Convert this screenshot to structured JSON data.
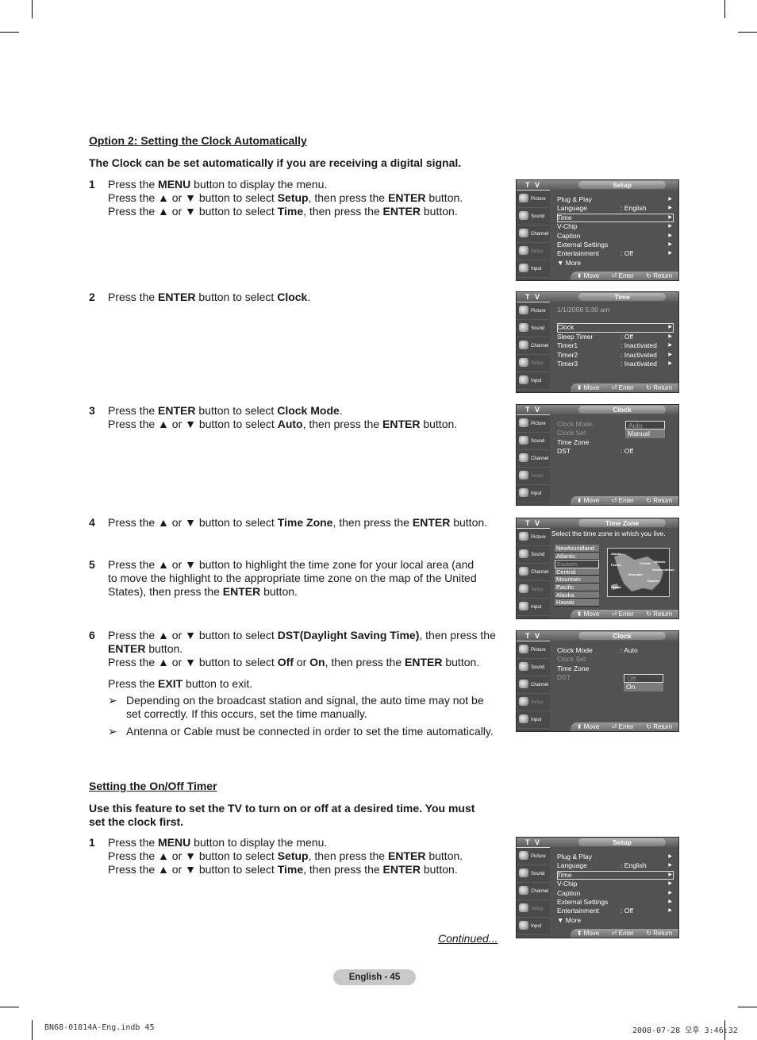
{
  "section1": {
    "heading": "Option 2: Setting the Clock Automatically",
    "intro": "The Clock can be set automatically if you are receiving a digital signal.",
    "steps": [
      {
        "num": "1",
        "lines": [
          [
            "Press the ",
            {
              "b": "MENU"
            },
            " button to display the menu."
          ],
          [
            "Press the ▲ or ▼ button to select ",
            {
              "b": "Setup"
            },
            ", then press the ",
            {
              "b": "ENTER"
            },
            " button."
          ],
          [
            "Press the ▲ or ▼ button to select ",
            {
              "b": "Time"
            },
            ", then press the ",
            {
              "b": "ENTER"
            },
            " button."
          ]
        ]
      },
      {
        "num": "2",
        "lines": [
          [
            "Press the ",
            {
              "b": "ENTER"
            },
            " button to select ",
            {
              "b": "Clock"
            },
            "."
          ]
        ]
      },
      {
        "num": "3",
        "lines": [
          [
            "Press the ",
            {
              "b": "ENTER"
            },
            " button to select ",
            {
              "b": "Clock Mode"
            },
            "."
          ],
          [
            "Press the ▲ or ▼ button to select ",
            {
              "b": "Auto"
            },
            ", then press the ",
            {
              "b": "ENTER"
            },
            " button."
          ]
        ]
      },
      {
        "num": "4",
        "lines": [
          [
            "Press the ▲ or ▼ button to select ",
            {
              "b": "Time Zone"
            },
            ", then press the ",
            {
              "b": "ENTER"
            },
            " button."
          ]
        ]
      },
      {
        "num": "5",
        "lines": [
          [
            "Press the ▲ or ▼ button to highlight the time zone for your local area (and"
          ],
          [
            "to move the highlight to the appropriate time zone on the map of the United"
          ],
          [
            "States), then press the ",
            {
              "b": "ENTER"
            },
            " button."
          ]
        ]
      },
      {
        "num": "6",
        "lines": [
          [
            "Press the ▲ or ▼ button to select ",
            {
              "b": "DST(Daylight Saving Time)"
            },
            ", then press the"
          ],
          [
            {
              "b": "ENTER"
            },
            " button."
          ],
          [
            "Press the ▲ or ▼ button to select ",
            {
              "b": "Off"
            },
            " or ",
            {
              "b": "On"
            },
            ", then press the ",
            {
              "b": "ENTER"
            },
            " button."
          ]
        ]
      }
    ],
    "exit_line": [
      "Press the ",
      {
        "b": "EXIT"
      },
      " button to exit."
    ],
    "notes": [
      "Depending on the broadcast station and signal, the auto time may not be set correctly. If this occurs, set the time manually.",
      "Antenna or Cable must be connected in order to set the time automatically."
    ],
    "note_arrow": "➢"
  },
  "section2": {
    "heading": "Setting the On/Off Timer",
    "intro": "Use this feature to set the TV to turn on or off at a desired time. You must set the clock first.",
    "steps": [
      {
        "num": "1",
        "lines": [
          [
            "Press the ",
            {
              "b": "MENU"
            },
            " button to display the menu."
          ],
          [
            "Press the ▲ or ▼ button to select ",
            {
              "b": "Setup"
            },
            ", then press the ",
            {
              "b": "ENTER"
            },
            " button."
          ],
          [
            "Press the ▲ or ▼ button to select ",
            {
              "b": "Time"
            },
            ", then press the ",
            {
              "b": "ENTER"
            },
            " button."
          ]
        ]
      }
    ]
  },
  "continued": "Continued...",
  "page_label": "English - 45",
  "footer": {
    "left": "BN68-01814A-Eng.indb   45",
    "right": "2008-07-28   오후 3:46:32"
  },
  "osd_common": {
    "tv_label": "T V",
    "sidebar": [
      {
        "label": "Picture",
        "icon": "picture-icon"
      },
      {
        "label": "Sound",
        "icon": "sound-icon"
      },
      {
        "label": "Channel",
        "icon": "channel-icon"
      },
      {
        "label": "Setup",
        "icon": "setup-icon"
      },
      {
        "label": "Input",
        "icon": "input-icon"
      }
    ],
    "bottom": {
      "move": "⬍ Move",
      "enter": "⏎ Enter",
      "return": "↻ Return"
    }
  },
  "osd_screens": [
    {
      "title": "Setup",
      "rows": [
        {
          "label": "Plug & Play",
          "value": "",
          "arrow": true
        },
        {
          "label": "Language",
          "value": ": English",
          "arrow": true
        },
        {
          "label": "Time",
          "value": "",
          "arrow": true,
          "selected": true
        },
        {
          "label": "V-Chip",
          "value": "",
          "arrow": true
        },
        {
          "label": "Caption",
          "value": "",
          "arrow": true
        },
        {
          "label": "External Settings",
          "value": "",
          "arrow": true
        },
        {
          "label": "Entertainment",
          "value": ": Off",
          "arrow": true
        },
        {
          "label": "▼ More",
          "value": "",
          "arrow": false
        }
      ]
    },
    {
      "title": "Time",
      "date": "1/1/2008 5:30 am",
      "rows": [
        {
          "label": "Clock",
          "value": "",
          "arrow": true,
          "selected": true
        },
        {
          "label": "Sleep Timer",
          "value": ": Off",
          "arrow": true
        },
        {
          "label": "Timer1",
          "value": ": Inactivated",
          "arrow": true
        },
        {
          "label": "Timer2",
          "value": ": Inactivated",
          "arrow": true
        },
        {
          "label": "Timer3",
          "value": ": Inactivated",
          "arrow": true
        }
      ]
    },
    {
      "title": "Clock",
      "rows": [
        {
          "label": "Clock Mode",
          "value": "",
          "arrow": false,
          "dim": true
        },
        {
          "label": "Clock Set",
          "value": "",
          "arrow": false,
          "dim": true
        },
        {
          "label": "Time Zone",
          "value": "",
          "arrow": false
        },
        {
          "label": "DST",
          "value": ": Off",
          "arrow": false
        }
      ],
      "popup": {
        "options": [
          "Auto",
          "Manual"
        ],
        "current": "Auto",
        "highlighted": "Manual"
      }
    },
    {
      "title": "Time Zone",
      "caption": "Select the time zone in which you live.",
      "zones": [
        "Newfoundland",
        "Atlantic",
        "Eastern",
        "Central",
        "Mountain",
        "Pacific",
        "Alaska",
        "Hawaii"
      ],
      "current_zone": "Eastern",
      "map_labels": [
        "Alaska",
        "Pacific",
        "Mountain",
        "Central",
        "Atlantic",
        "Newfoundland",
        "Eastern",
        "Hawaii"
      ]
    },
    {
      "title": "Clock",
      "rows": [
        {
          "label": "Clock Mode",
          "value": ": Auto",
          "arrow": false
        },
        {
          "label": "Clock Set",
          "value": "",
          "arrow": false,
          "dim": true
        },
        {
          "label": "Time Zone",
          "value": "",
          "arrow": false
        },
        {
          "label": "DST",
          "value": "",
          "arrow": false,
          "dim": true
        }
      ],
      "popup": {
        "options": [
          "Off",
          "On"
        ],
        "current": "Off",
        "highlighted": "On"
      }
    },
    {
      "title": "Setup",
      "rows": [
        {
          "label": "Plug & Play",
          "value": "",
          "arrow": true
        },
        {
          "label": "Language",
          "value": ": English",
          "arrow": true
        },
        {
          "label": "Time",
          "value": "",
          "arrow": true,
          "selected": true
        },
        {
          "label": "V-Chip",
          "value": "",
          "arrow": true
        },
        {
          "label": "Caption",
          "value": "",
          "arrow": true
        },
        {
          "label": "External Settings",
          "value": "",
          "arrow": true
        },
        {
          "label": "Entertainment",
          "value": ": Off",
          "arrow": true
        },
        {
          "label": "▼ More",
          "value": "",
          "arrow": false
        }
      ]
    }
  ]
}
